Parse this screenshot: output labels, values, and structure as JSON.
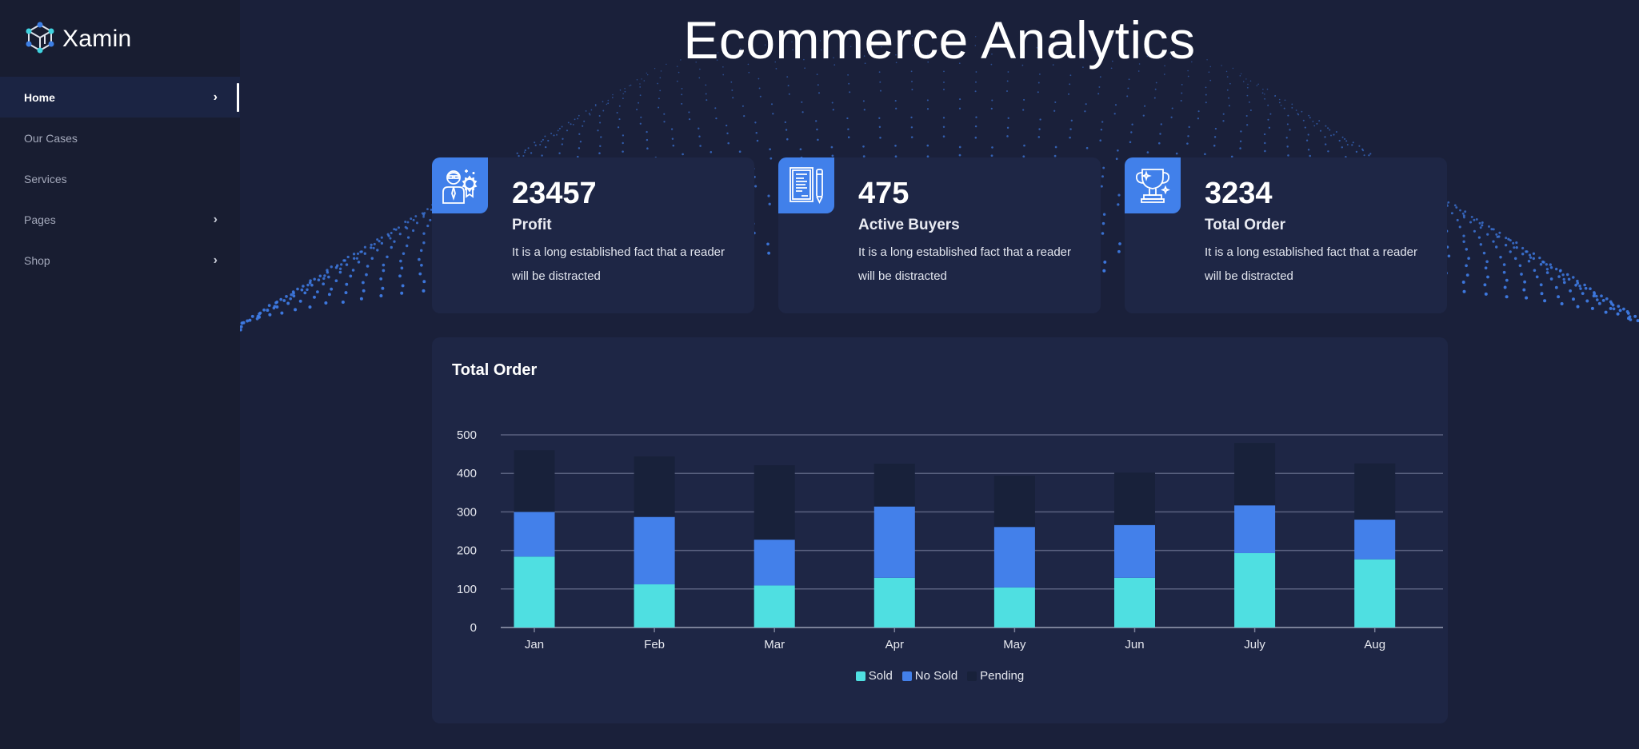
{
  "brand": {
    "name": "Xamin",
    "icon": "network-cube-icon"
  },
  "sidebar": {
    "items": [
      {
        "label": "Home",
        "active": true,
        "has_chevron": true
      },
      {
        "label": "Our Cases",
        "active": false,
        "has_chevron": false
      },
      {
        "label": "Services",
        "active": false,
        "has_chevron": false
      },
      {
        "label": "Pages",
        "active": false,
        "has_chevron": true
      },
      {
        "label": "Shop",
        "active": false,
        "has_chevron": true
      }
    ],
    "chevron_glyph": "›"
  },
  "header": {
    "title": "Ecommerce Analytics"
  },
  "stats": [
    {
      "value": "23457",
      "label": "Profit",
      "description": "It is a long established fact that a reader will be distracted",
      "icon": "businessman-award-icon"
    },
    {
      "value": "475",
      "label": "Active Buyers",
      "description": "It is a long established fact that a reader will be distracted",
      "icon": "document-pen-icon"
    },
    {
      "value": "3234",
      "label": "Total Order",
      "description": "It is a long established fact that a reader will be distracted",
      "icon": "trophy-icon"
    }
  ],
  "colors": {
    "accent": "#4180ea",
    "sold": "#4fdfe1",
    "no_sold": "#4380ea",
    "pending": "#18213a",
    "grid": "#5a6180",
    "axis_text": "#e6e8ef"
  },
  "chart_data": {
    "type": "bar",
    "stacked": true,
    "title": "Total Order",
    "xlabel": "",
    "ylabel": "",
    "categories": [
      "Jan",
      "Feb",
      "Mar",
      "Apr",
      "May",
      "Jun",
      "July",
      "Aug"
    ],
    "series": [
      {
        "name": "Sold",
        "values": [
          184,
          112,
          109,
          129,
          104,
          129,
          193,
          177
        ]
      },
      {
        "name": "No Sold",
        "values": [
          116,
          175,
          119,
          185,
          157,
          137,
          124,
          103
        ]
      },
      {
        "name": "Pending",
        "values": [
          160,
          157,
          193,
          111,
          133,
          136,
          162,
          146
        ]
      }
    ],
    "ylim": [
      0,
      500
    ],
    "yticks": [
      0,
      100,
      200,
      300,
      400,
      500
    ],
    "grid": true,
    "legend": "bottom-center"
  }
}
